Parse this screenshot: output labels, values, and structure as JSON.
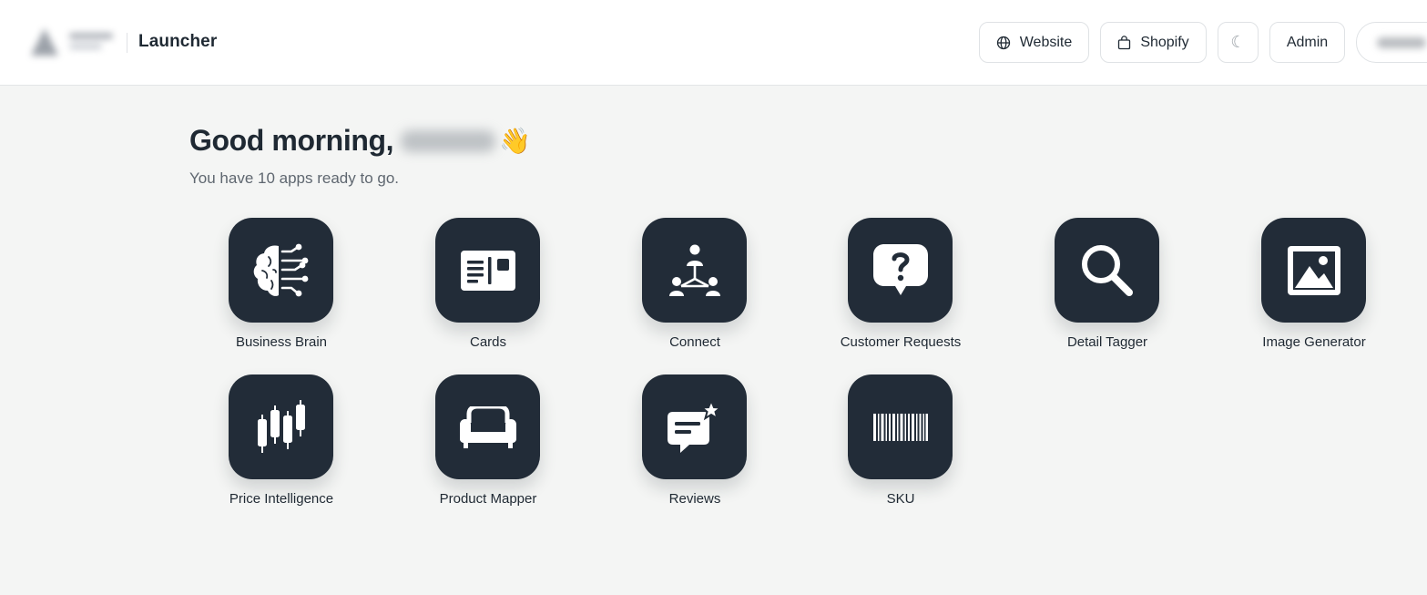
{
  "header": {
    "app_title": "Launcher",
    "buttons": {
      "website": "Website",
      "shopify": "Shopify",
      "theme_icon": "☾",
      "admin": "Admin"
    }
  },
  "greeting": {
    "prefix": "Good morning,",
    "wave": "👋",
    "subtitle": "You have 10 apps ready to go."
  },
  "apps": [
    {
      "label": "Business Brain",
      "icon": "brain-circuit-icon"
    },
    {
      "label": "Cards",
      "icon": "id-card-icon"
    },
    {
      "label": "Connect",
      "icon": "network-people-icon"
    },
    {
      "label": "Customer Requests",
      "icon": "question-bubble-icon"
    },
    {
      "label": "Detail Tagger",
      "icon": "magnifier-icon"
    },
    {
      "label": "Image Generator",
      "icon": "image-icon"
    },
    {
      "label": "Price Intelligence",
      "icon": "candlestick-icon"
    },
    {
      "label": "Product Mapper",
      "icon": "sofa-icon"
    },
    {
      "label": "Reviews",
      "icon": "review-bubble-star-icon"
    },
    {
      "label": "SKU",
      "icon": "barcode-icon"
    }
  ],
  "colors": {
    "tile": "#222c38",
    "background": "#f4f5f4",
    "header": "#ffffff"
  }
}
